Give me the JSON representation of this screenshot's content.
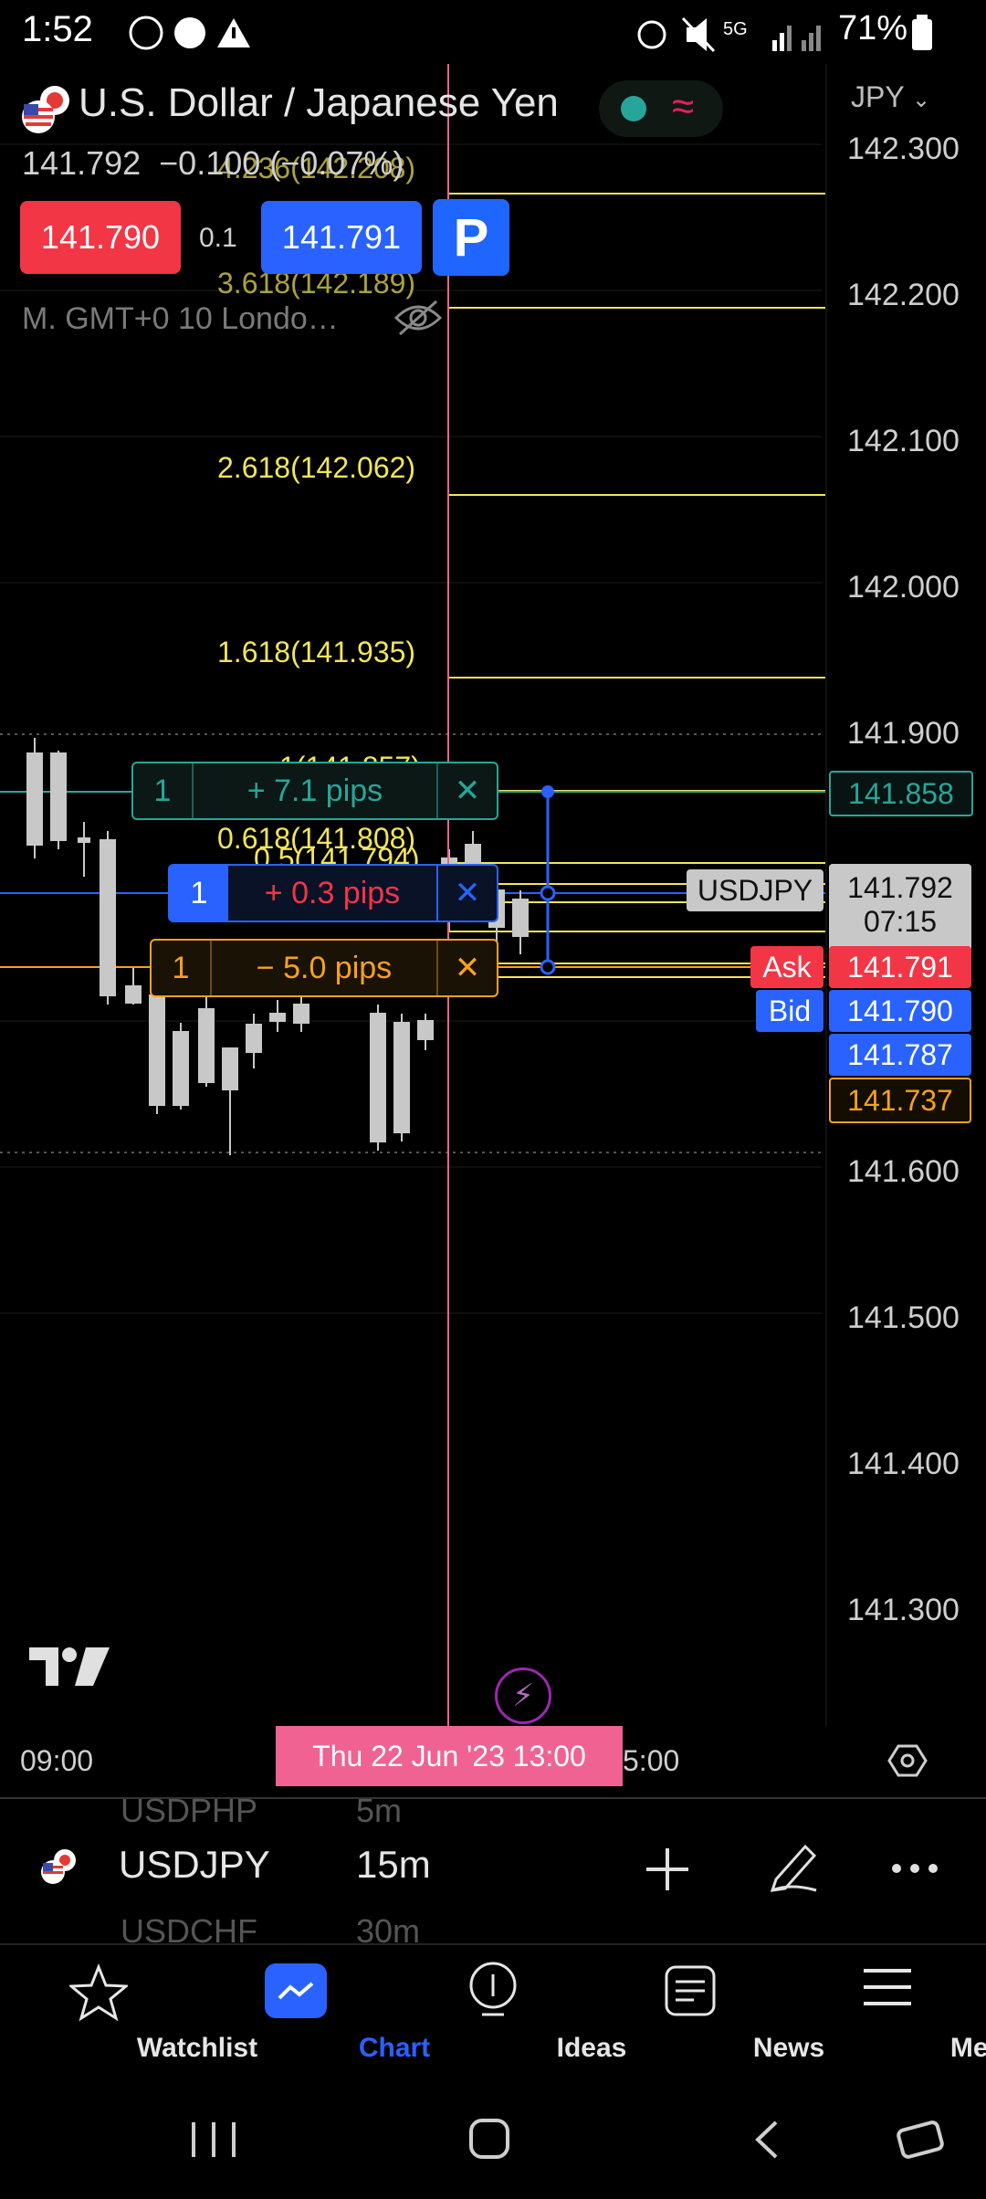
{
  "status_bar": {
    "time": "1:52",
    "network": "5G",
    "battery": "71%"
  },
  "header": {
    "title": "U.S. Dollar / Japanese Yen",
    "currency": "JPY",
    "last_price": "141.792",
    "change": "−0.100 (−0.07%)",
    "sell_price": "141.790",
    "spread": "0.1",
    "buy_price": "141.791",
    "session": "M. GMT+0 10 Londo…"
  },
  "price_axis": {
    "levels": [
      "142.300",
      "142.200",
      "142.100",
      "142.000",
      "141.900",
      "141.600",
      "141.500",
      "141.400",
      "141.300"
    ]
  },
  "fib_levels": [
    {
      "label": "4.236(142.208)"
    },
    {
      "label": "3.618(142.189)"
    },
    {
      "label": "2.618(142.062)"
    },
    {
      "label": "1.618(141.935)"
    },
    {
      "label": "1(141.857)"
    },
    {
      "label": "0.618(141.808)"
    },
    {
      "label": "0.5(141.794)"
    }
  ],
  "orders": {
    "take_profit": {
      "qty": "1",
      "text": "+ 7.1 pips",
      "price": "141.858"
    },
    "position": {
      "qty": "1",
      "text": "+ 0.3 pips"
    },
    "stop_loss": {
      "qty": "1",
      "text": "− 5.0 pips",
      "price": "141.737"
    }
  },
  "axis_tags": {
    "symbol": "USDJPY",
    "last": "141.792",
    "countdown": "07:15",
    "ask_label": "Ask",
    "ask": "141.791",
    "bid_label": "Bid",
    "bid": "141.790",
    "other": "141.787"
  },
  "time_axis": {
    "left_tick": "09:00",
    "crosshair": "Thu 22 Jun '23   13:00",
    "right_tick": "5:00"
  },
  "symbol_bar": {
    "prev_symbol": "USDPHP",
    "prev_interval": "5m",
    "symbol": "USDJPY",
    "interval": "15m",
    "next_symbol": "USDCHF",
    "next_interval": "30m"
  },
  "bottom_nav": [
    {
      "label": "Watchlist"
    },
    {
      "label": "Chart"
    },
    {
      "label": "Ideas"
    },
    {
      "label": "News"
    },
    {
      "label": "Menu"
    }
  ],
  "colors": {
    "accent": "#2962ff",
    "sell": "#f23645",
    "fib": "#f2e55a",
    "take_profit": "#26a69a",
    "stop_loss": "#f7a21b",
    "crosshair": "#f06292"
  }
}
